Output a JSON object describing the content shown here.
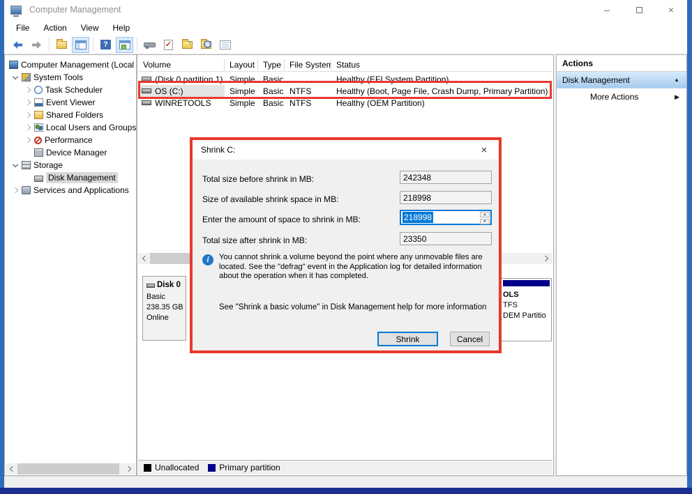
{
  "window": {
    "title": "Computer Management"
  },
  "menu": {
    "items": [
      "File",
      "Action",
      "View",
      "Help"
    ]
  },
  "toolbar": {
    "icons": [
      "back",
      "forward",
      "folder",
      "show-console-tree-toggle",
      "help",
      "show-action-pane-toggle",
      "console-tool",
      "document-check",
      "folder-up",
      "folder-search",
      "task-list"
    ]
  },
  "tree": {
    "items": [
      {
        "label": "Computer Management (Local",
        "icon": "computer"
      },
      {
        "label": "System Tools",
        "icon": "tools"
      },
      {
        "label": "Task Scheduler",
        "icon": "clock"
      },
      {
        "label": "Event Viewer",
        "icon": "event-viewer"
      },
      {
        "label": "Shared Folders",
        "icon": "shared-folder"
      },
      {
        "label": "Local Users and Groups",
        "icon": "users"
      },
      {
        "label": "Performance",
        "icon": "performance"
      },
      {
        "label": "Device Manager",
        "icon": "device"
      },
      {
        "label": "Storage",
        "icon": "storage"
      },
      {
        "label": "Disk Management",
        "icon": "disk"
      },
      {
        "label": "Services and Applications",
        "icon": "services"
      }
    ]
  },
  "volume_table": {
    "headers": [
      "Volume",
      "Layout",
      "Type",
      "File System",
      "Status"
    ],
    "rows": [
      {
        "volume": "(Disk 0 partition 1)",
        "layout": "Simple",
        "type": "Basic",
        "fs": "",
        "status": "Healthy (EFI System Partition)"
      },
      {
        "volume": "OS (C:)",
        "layout": "Simple",
        "type": "Basic",
        "fs": "NTFS",
        "status": "Healthy (Boot, Page File, Crash Dump, Primary Partition)"
      },
      {
        "volume": "WINRETOOLS",
        "layout": "Simple",
        "type": "Basic",
        "fs": "NTFS",
        "status": "Healthy (OEM Partition)"
      }
    ]
  },
  "disk_view": {
    "disk0": {
      "name": "Disk 0",
      "type": "Basic",
      "size": "238.35 GB",
      "status": "Online"
    },
    "partition_fragment": {
      "line1": "OLS",
      "line2": "TFS",
      "line3": "DEM Partitio"
    }
  },
  "legend": {
    "unallocated": "Unallocated",
    "primary": "Primary partition"
  },
  "actions": {
    "title": "Actions",
    "group": "Disk Management",
    "more": "More Actions"
  },
  "dialog": {
    "title": "Shrink C:",
    "rows": [
      {
        "label": "Total size before shrink in MB:",
        "value": "242348"
      },
      {
        "label": "Size of available shrink space in MB:",
        "value": "218998"
      },
      {
        "label": "Enter the amount of space to shrink in MB:",
        "value": "218998"
      },
      {
        "label": "Total size after shrink in MB:",
        "value": "23350"
      }
    ],
    "info_text": "You cannot shrink a volume beyond the point where any unmovable files are located. See the \"defrag\" event in the Application log for detailed information about the operation when it has completed.",
    "help_text": "See \"Shrink a basic volume\" in Disk Management help for more information",
    "shrink_button": "Shrink",
    "cancel_button": "Cancel"
  },
  "icons": {
    "close": "×",
    "minimize": "–",
    "maximize": "square",
    "collapse": "▲",
    "expand_right": "▶",
    "spin_up": "▲",
    "spin_down": "▼",
    "info": "i",
    "help": "?",
    "check": "✓",
    "up_arrow": "↑"
  },
  "colors": {
    "annotation_red": "#e8392c",
    "selection_blue": "#0078d7",
    "primary_partition_navy": "#000089",
    "unallocated_black": "#000000",
    "desktop_blue": "#2f6db8",
    "taskbar_navy": "#1a2f90"
  }
}
